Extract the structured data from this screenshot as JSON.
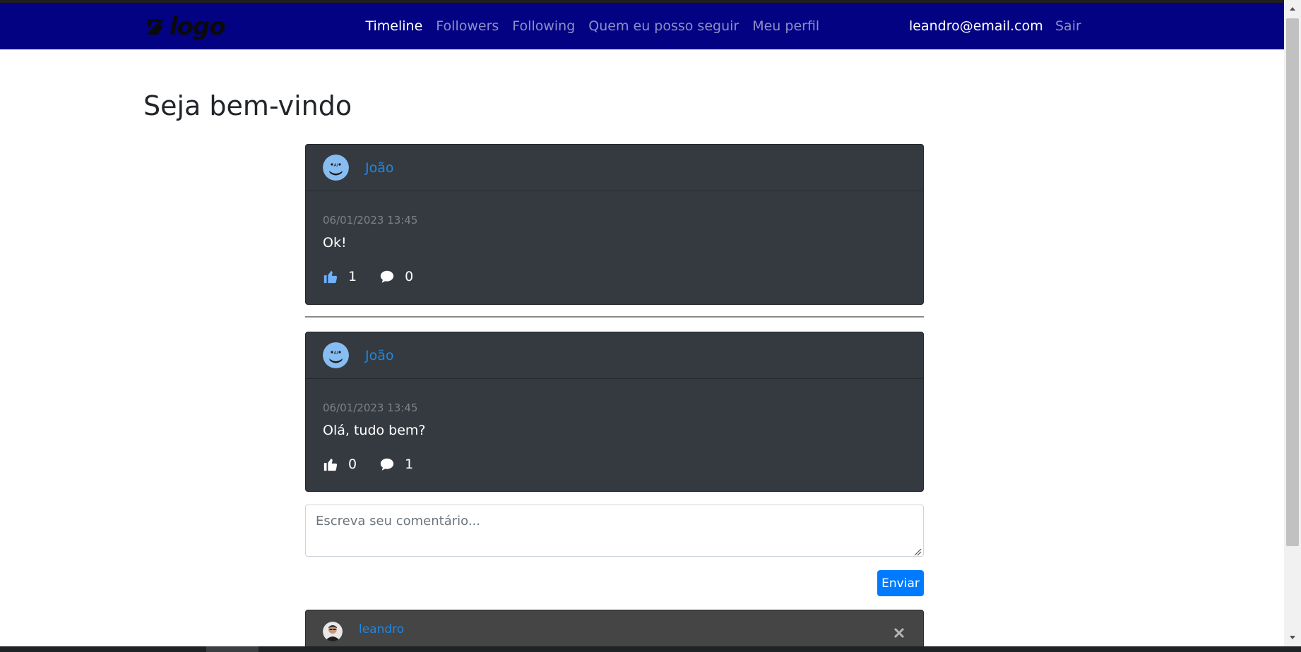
{
  "navbar": {
    "logo_text": "logo",
    "links": [
      {
        "label": "Timeline",
        "active": true
      },
      {
        "label": "Followers",
        "active": false
      },
      {
        "label": "Following",
        "active": false
      },
      {
        "label": "Quem eu posso seguir",
        "active": false
      },
      {
        "label": "Meu perfil",
        "active": false
      }
    ],
    "user_email": "leandro@email.com",
    "logout_label": "Sair"
  },
  "page": {
    "title": "Seja bem-vindo"
  },
  "posts": [
    {
      "author": "João",
      "date": "06/01/2023 13:45",
      "text": "Ok!",
      "likes": "1",
      "comments": "0",
      "liked": true
    },
    {
      "author": "João",
      "date": "06/01/2023 13:45",
      "text": "Olá, tudo bem?",
      "likes": "0",
      "comments": "1",
      "liked": false
    }
  ],
  "comment_form": {
    "placeholder": "Escreva seu comentário...",
    "value": "",
    "submit_label": "Enviar"
  },
  "comments": [
    {
      "author": "leandro"
    }
  ],
  "colors": {
    "navbar_bg": "#020283",
    "card_bg": "#343a40",
    "link_blue": "#1e88e5",
    "like_active": "#6fb0ff",
    "primary_button": "#007bff"
  }
}
